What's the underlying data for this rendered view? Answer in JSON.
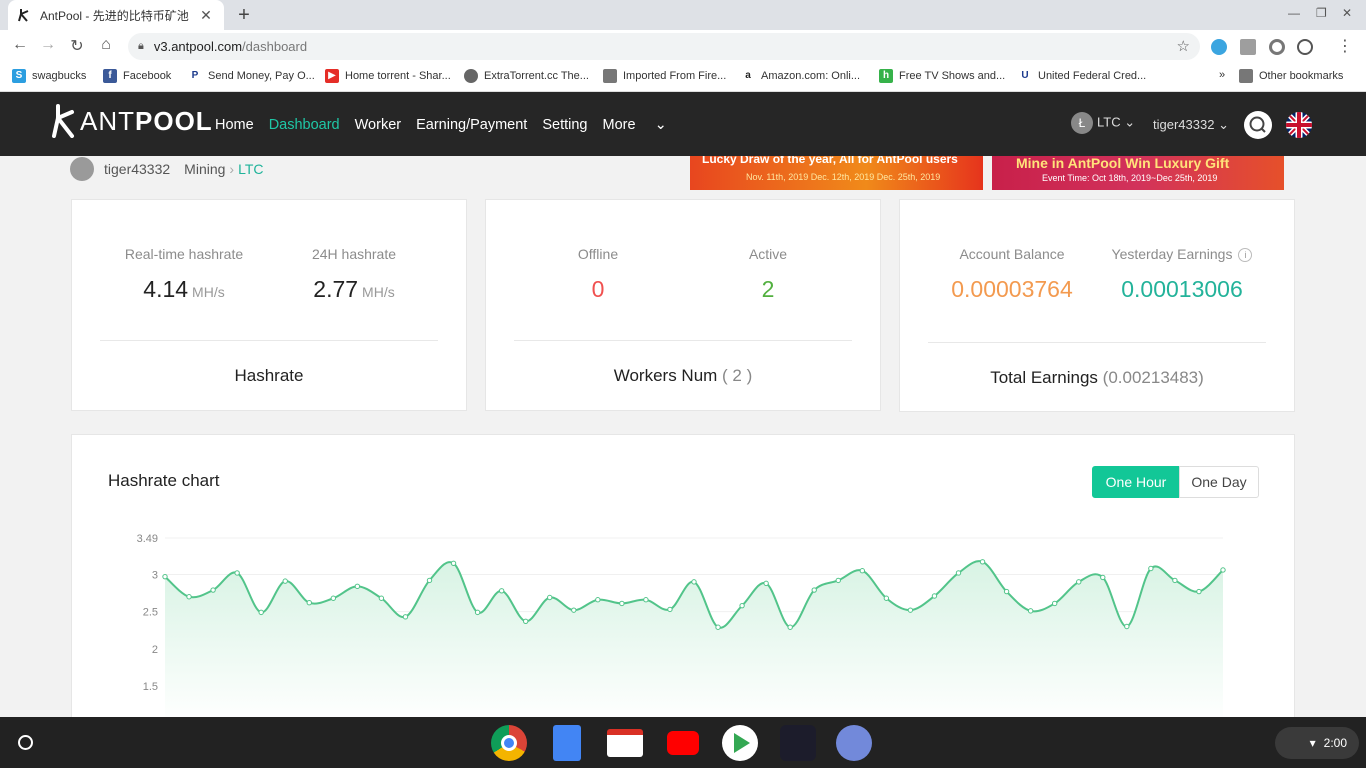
{
  "browser": {
    "tab_title": "AntPool - 先进的比特币矿池",
    "url_host": "v3.antpool.com",
    "url_path": "/dashboard",
    "bookmarks": [
      "swagbucks",
      "Facebook",
      "Send Money, Pay O...",
      "Home torrent - Shar...",
      "ExtraTorrent.cc The...",
      "Imported From Fire...",
      "Amazon.com: Onli...",
      "Free TV Shows and...",
      "United Federal Cred..."
    ],
    "bookmarks_overflow": "»",
    "other_bookmarks": "Other bookmarks"
  },
  "site": {
    "logo_ant": "ANT",
    "logo_pool": "POOL",
    "menu": [
      "Home",
      "Dashboard",
      "Worker",
      "Earning/Payment",
      "Setting",
      "More"
    ],
    "active_menu": "Dashboard",
    "coin": "LTC",
    "user": "tiger43332"
  },
  "breadcrumb": {
    "user": "tiger43332",
    "section": "Mining",
    "coin": "LTC"
  },
  "banners": [
    {
      "headline": "Lucky Draw of the year, All for AntPool users",
      "dates": "Nov. 11th, 2019   Dec. 12th, 2019   Dec. 25th, 2019"
    },
    {
      "headline": "Mine in AntPool  Win Luxury Gift",
      "dates": "Event Time: Oct 18th, 2019~Dec 25th, 2019"
    }
  ],
  "cards": {
    "hashrate": {
      "realtime_label": "Real-time hashrate",
      "realtime_value": "4.14",
      "realtime_unit": "MH/s",
      "day_label": "24H hashrate",
      "day_value": "2.77",
      "day_unit": "MH/s",
      "footer": "Hashrate"
    },
    "workers": {
      "offline_label": "Offline",
      "offline_value": "0",
      "active_label": "Active",
      "active_value": "2",
      "footer": "Workers Num",
      "footer_count": "( 2 )"
    },
    "earnings": {
      "balance_label": "Account Balance",
      "balance_value": "0.00003764",
      "yesterday_label": "Yesterday Earnings",
      "yesterday_value": "0.00013006",
      "footer": "Total Earnings",
      "footer_total": "(0.00213483)"
    }
  },
  "chart_panel": {
    "title": "Hashrate chart",
    "range_buttons": [
      "One Hour",
      "One Day"
    ],
    "selected_range": "One Hour"
  },
  "chart_data": {
    "type": "area",
    "ylim": [
      1.5,
      3.49
    ],
    "yticks": [
      "3.49",
      "3",
      "2.5",
      "2",
      "1.5"
    ],
    "ytick_values": [
      3.49,
      3,
      2.5,
      2,
      1.5
    ],
    "values": [
      2.97,
      2.7,
      2.79,
      3.02,
      2.49,
      2.91,
      2.62,
      2.68,
      2.84,
      2.68,
      2.43,
      2.92,
      3.15,
      2.49,
      2.78,
      2.37,
      2.69,
      2.52,
      2.66,
      2.61,
      2.66,
      2.53,
      2.9,
      2.29,
      2.58,
      2.88,
      2.29,
      2.79,
      2.92,
      3.05,
      2.68,
      2.52,
      2.71,
      3.02,
      3.17,
      2.77,
      2.51,
      2.61,
      2.9,
      2.96,
      2.3,
      3.08,
      2.92,
      2.77,
      3.06
    ],
    "line_color": "#52c48a",
    "fill_color": "#d8f3e4",
    "grid": true
  },
  "system": {
    "time": "2:00"
  }
}
